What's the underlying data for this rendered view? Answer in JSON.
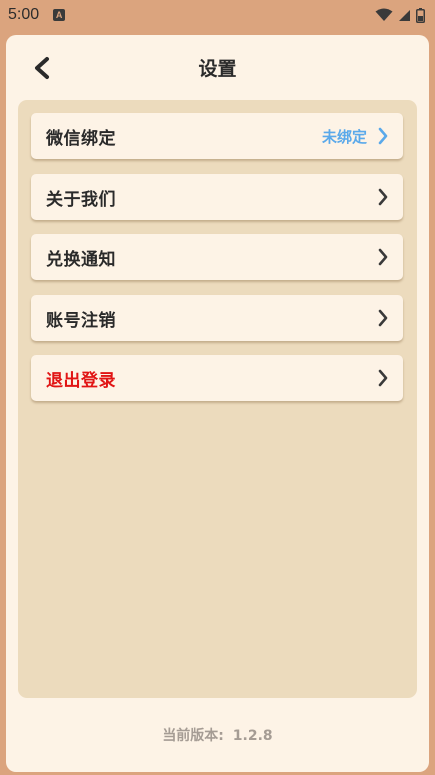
{
  "status_bar": {
    "time": "5:00",
    "app_icon_letter": "A",
    "icons": [
      "wifi-icon",
      "cell-signal-icon",
      "battery-icon"
    ]
  },
  "header": {
    "title": "设置",
    "back_icon": "chevron-left-icon"
  },
  "menu": {
    "items": [
      {
        "label": "微信绑定",
        "value": "未绑定",
        "value_color": "#5aa9ea",
        "chevron_color": "#5aa9ea"
      },
      {
        "label": "关于我们"
      },
      {
        "label": "兑换通知"
      },
      {
        "label": "账号注销"
      },
      {
        "label": "退出登录",
        "label_color": "#e11414"
      }
    ]
  },
  "footer": {
    "version_label": "当前版本:",
    "version_number": "1.2.8"
  },
  "colors": {
    "background": "#dba47e",
    "card": "#fdf3e6",
    "panel": "#ecdbbd",
    "accent": "#5aa9ea",
    "danger": "#e11414"
  }
}
